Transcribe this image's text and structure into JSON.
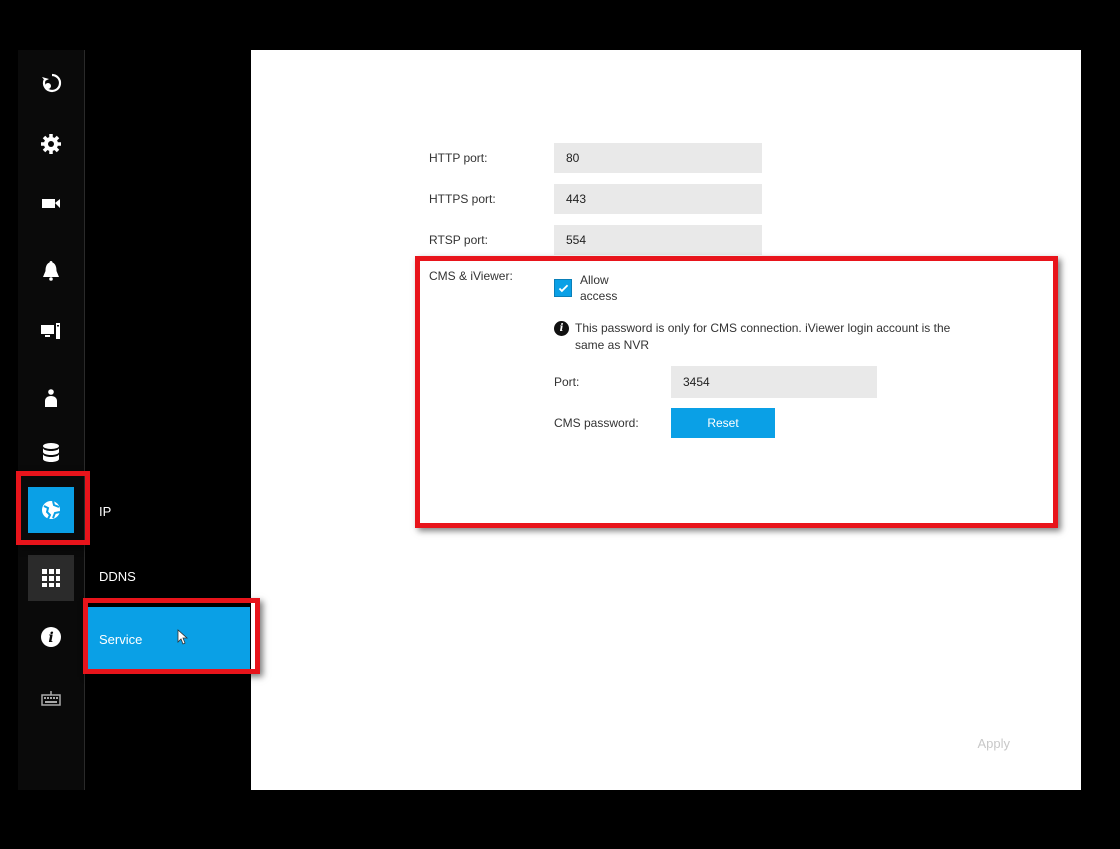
{
  "rail": {
    "items": [
      {
        "name": "rewind-icon"
      },
      {
        "name": "gear-icon"
      },
      {
        "name": "camera-icon"
      },
      {
        "name": "bell-icon"
      },
      {
        "name": "monitor-icon"
      },
      {
        "name": "user-icon"
      },
      {
        "name": "database-icon"
      },
      {
        "name": "network-icon",
        "active": true
      },
      {
        "name": "apps-grid-icon"
      },
      {
        "name": "info-icon"
      },
      {
        "name": "keyboard-icon"
      }
    ]
  },
  "submenu": {
    "items": [
      {
        "label": "IP"
      },
      {
        "label": "DDNS"
      },
      {
        "label": "Service",
        "active": true
      }
    ]
  },
  "form": {
    "http_port_label": "HTTP port:",
    "http_port_value": "80",
    "https_port_label": "HTTPS port:",
    "https_port_value": "443",
    "rtsp_port_label": "RTSP port:",
    "rtsp_port_value": "554",
    "cms_label": "CMS & iViewer:",
    "allow_label_line1": "Allow",
    "allow_label_line2": "access",
    "allow_checked": true,
    "info_line1": "This password is only for CMS connection. iViewer login account is the",
    "info_line2": "same as NVR",
    "port_label": "Port:",
    "port_value": "3454",
    "cms_password_label": "CMS password:",
    "reset_label": "Reset"
  },
  "footer": {
    "apply_label": "Apply"
  },
  "colors": {
    "accent": "#0aa0e6",
    "highlight": "#e8141b"
  }
}
